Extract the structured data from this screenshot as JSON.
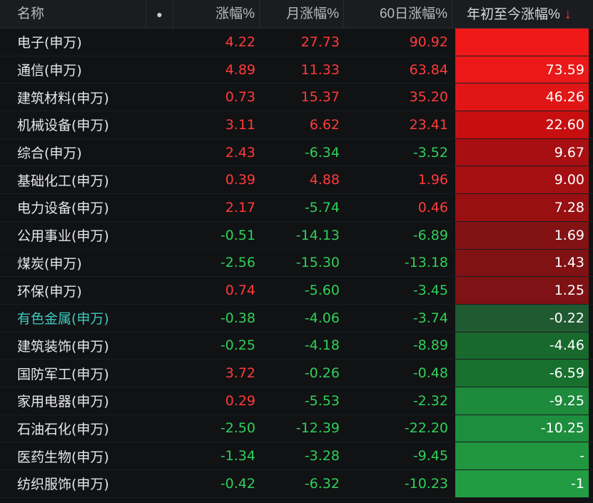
{
  "header": {
    "name": "名称",
    "dot": "●",
    "change_pct": "涨幅%",
    "month_pct": "月涨幅%",
    "d60_pct": "60日涨幅%",
    "ytd_pct": "年初至今涨幅%",
    "sort_arrow": "↓"
  },
  "rows": [
    {
      "name": "电子(申万)",
      "chg": "4.22",
      "mon": "27.73",
      "d60": "90.92",
      "ytd": "",
      "bg": "#f01818"
    },
    {
      "name": "通信(申万)",
      "chg": "4.89",
      "mon": "11.33",
      "d60": "63.84",
      "ytd": "73.59",
      "bg": "#ea1818"
    },
    {
      "name": "建筑材料(申万)",
      "chg": "0.73",
      "mon": "15.37",
      "d60": "35.20",
      "ytd": "46.26",
      "bg": "#e01616"
    },
    {
      "name": "机械设备(申万)",
      "chg": "3.11",
      "mon": "6.62",
      "d60": "23.41",
      "ytd": "22.60",
      "bg": "#c80f10"
    },
    {
      "name": "综合(申万)",
      "chg": "2.43",
      "mon": "-6.34",
      "d60": "-3.52",
      "ytd": "9.67",
      "bg": "#a80f12"
    },
    {
      "name": "基础化工(申万)",
      "chg": "0.39",
      "mon": "4.88",
      "d60": "1.96",
      "ytd": "9.00",
      "bg": "#a40f12"
    },
    {
      "name": "电力设备(申万)",
      "chg": "2.17",
      "mon": "-5.74",
      "d60": "0.46",
      "ytd": "7.28",
      "bg": "#981012"
    },
    {
      "name": "公用事业(申万)",
      "chg": "-0.51",
      "mon": "-14.13",
      "d60": "-6.89",
      "ytd": "1.69",
      "bg": "#821214"
    },
    {
      "name": "煤炭(申万)",
      "chg": "-2.56",
      "mon": "-15.30",
      "d60": "-13.18",
      "ytd": "1.43",
      "bg": "#801214"
    },
    {
      "name": "环保(申万)",
      "chg": "0.74",
      "mon": "-5.60",
      "d60": "-3.45",
      "ytd": "1.25",
      "bg": "#7e1214"
    },
    {
      "name": "有色金属(申万)",
      "chg": "-0.38",
      "mon": "-4.06",
      "d60": "-3.74",
      "ytd": "-0.22",
      "bg": "#1f5a30",
      "highlight": true
    },
    {
      "name": "建筑装饰(申万)",
      "chg": "-0.25",
      "mon": "-4.18",
      "d60": "-8.89",
      "ytd": "-4.46",
      "bg": "#176a2c"
    },
    {
      "name": "国防军工(申万)",
      "chg": "3.72",
      "mon": "-0.26",
      "d60": "-0.48",
      "ytd": "-6.59",
      "bg": "#17702e"
    },
    {
      "name": "家用电器(申万)",
      "chg": "0.29",
      "mon": "-5.53",
      "d60": "-2.32",
      "ytd": "-9.25",
      "bg": "#1d8a3c"
    },
    {
      "name": "石油石化(申万)",
      "chg": "-2.50",
      "mon": "-12.39",
      "d60": "-22.20",
      "ytd": "-10.25",
      "bg": "#1d8e3e"
    },
    {
      "name": "医药生物(申万)",
      "chg": "-1.34",
      "mon": "-3.28",
      "d60": "-9.45",
      "ytd": "-",
      "bg": "#20963f"
    },
    {
      "name": "纺织服饰(申万)",
      "chg": "-0.42",
      "mon": "-6.32",
      "d60": "-10.23",
      "ytd": "-1",
      "bg": "#229c42"
    }
  ]
}
